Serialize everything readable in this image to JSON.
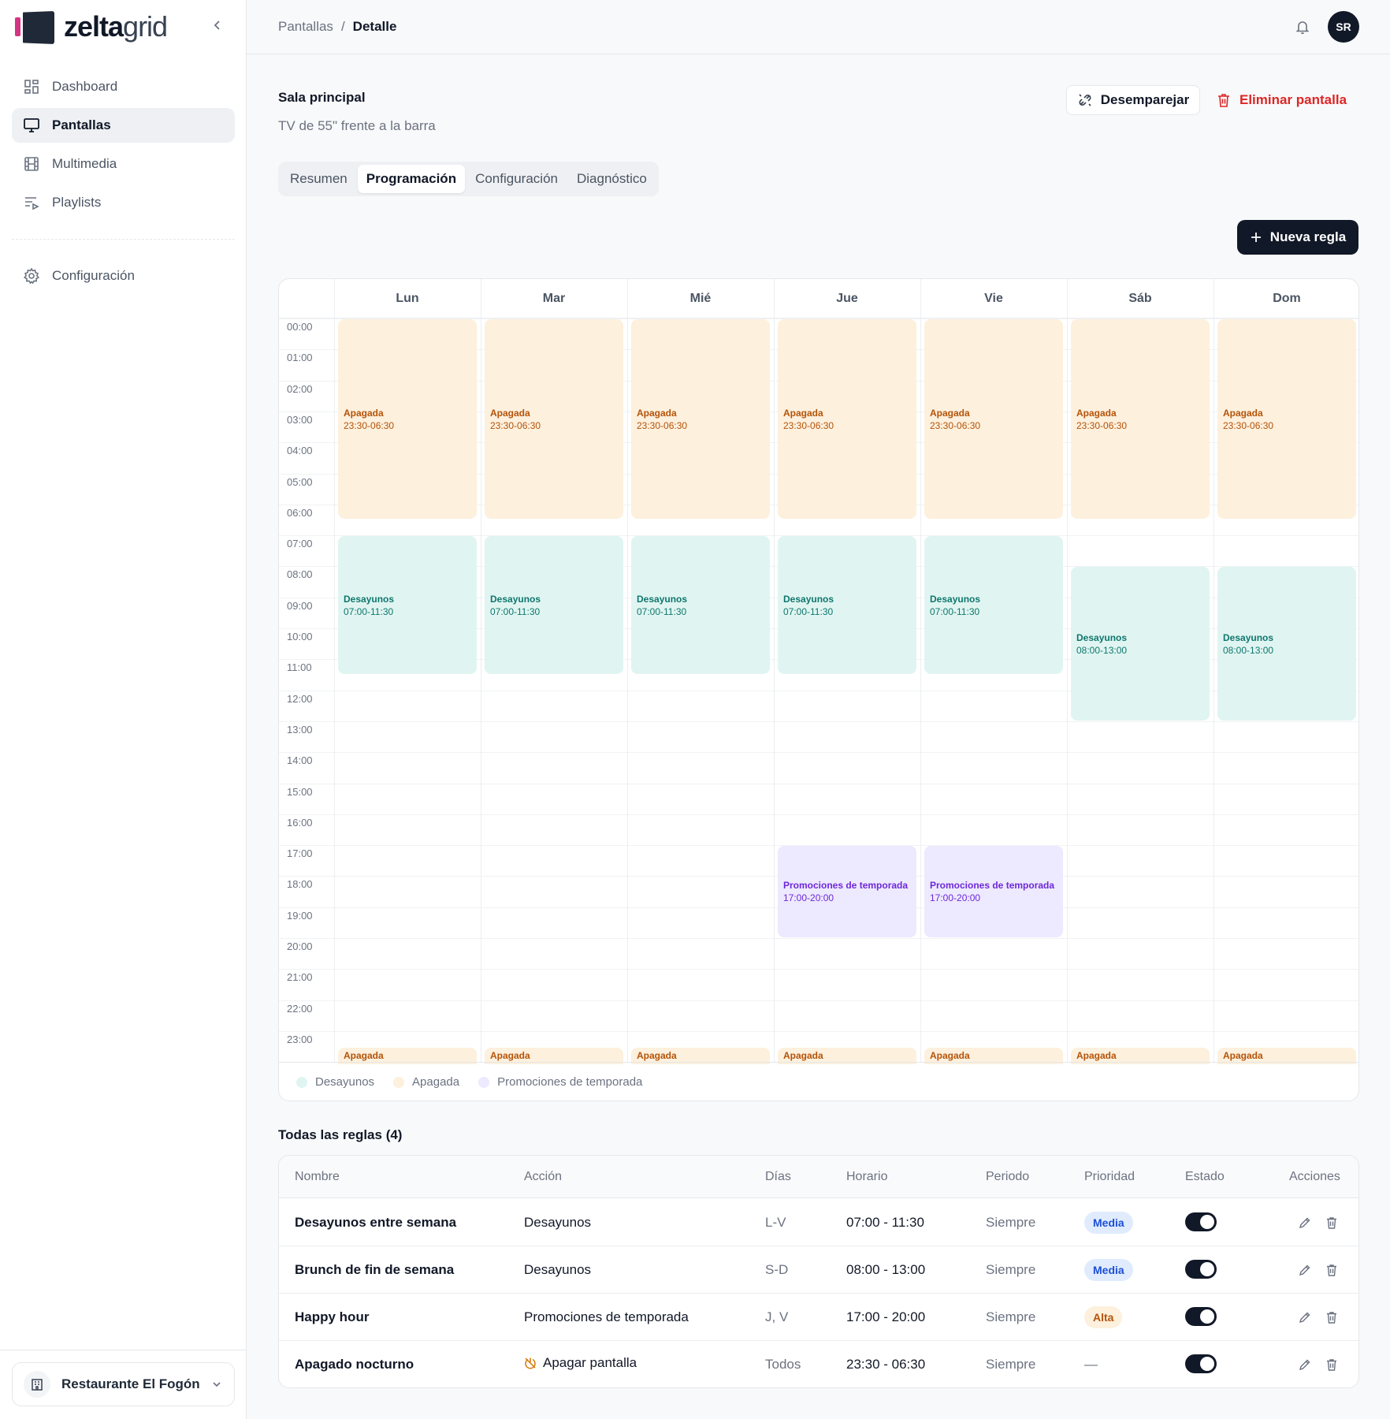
{
  "brand": {
    "name_bold": "zelta",
    "name_light": "grid"
  },
  "sidebar": {
    "items": [
      {
        "label": "Dashboard",
        "icon": "dashboard-icon",
        "active": false
      },
      {
        "label": "Pantallas",
        "icon": "monitor-icon",
        "active": true
      },
      {
        "label": "Multimedia",
        "icon": "film-icon",
        "active": false
      },
      {
        "label": "Playlists",
        "icon": "playlist-icon",
        "active": false
      }
    ],
    "settings": {
      "label": "Configuración",
      "icon": "gear-icon"
    },
    "organization": "Restaurante El Fogón"
  },
  "topbar": {
    "breadcrumb": [
      "Pantallas",
      "/",
      "Detalle"
    ],
    "avatar_initials": "SR"
  },
  "screen": {
    "title": "Sala principal",
    "description": "TV de 55\" frente a la barra",
    "unpair_label": "Desemparejar",
    "delete_label": "Eliminar pantalla"
  },
  "tabs": [
    {
      "label": "Resumen",
      "active": false
    },
    {
      "label": "Programación",
      "active": true
    },
    {
      "label": "Configuración",
      "active": false
    },
    {
      "label": "Diagnóstico",
      "active": false
    }
  ],
  "new_rule_label": "Nueva regla",
  "calendar": {
    "days": [
      "Lun",
      "Mar",
      "Mié",
      "Jue",
      "Vie",
      "Sáb",
      "Dom"
    ],
    "hours": [
      "00:00",
      "01:00",
      "02:00",
      "03:00",
      "04:00",
      "05:00",
      "06:00",
      "07:00",
      "08:00",
      "09:00",
      "10:00",
      "11:00",
      "12:00",
      "13:00",
      "14:00",
      "15:00",
      "16:00",
      "17:00",
      "18:00",
      "19:00",
      "20:00",
      "21:00",
      "22:00",
      "23:00"
    ],
    "events": [
      {
        "day": 0,
        "start": 0,
        "end": 6.5,
        "kind": "off",
        "label": "Apagada",
        "time": "23:30-06:30"
      },
      {
        "day": 1,
        "start": 0,
        "end": 6.5,
        "kind": "off",
        "label": "Apagada",
        "time": "23:30-06:30"
      },
      {
        "day": 2,
        "start": 0,
        "end": 6.5,
        "kind": "off",
        "label": "Apagada",
        "time": "23:30-06:30"
      },
      {
        "day": 3,
        "start": 0,
        "end": 6.5,
        "kind": "off",
        "label": "Apagada",
        "time": "23:30-06:30"
      },
      {
        "day": 4,
        "start": 0,
        "end": 6.5,
        "kind": "off",
        "label": "Apagada",
        "time": "23:30-06:30"
      },
      {
        "day": 5,
        "start": 0,
        "end": 6.5,
        "kind": "off",
        "label": "Apagada",
        "time": "23:30-06:30"
      },
      {
        "day": 6,
        "start": 0,
        "end": 6.5,
        "kind": "off",
        "label": "Apagada",
        "time": "23:30-06:30"
      },
      {
        "day": 0,
        "start": 7,
        "end": 11.5,
        "kind": "bk",
        "label": "Desayunos",
        "time": "07:00-11:30"
      },
      {
        "day": 1,
        "start": 7,
        "end": 11.5,
        "kind": "bk",
        "label": "Desayunos",
        "time": "07:00-11:30"
      },
      {
        "day": 2,
        "start": 7,
        "end": 11.5,
        "kind": "bk",
        "label": "Desayunos",
        "time": "07:00-11:30"
      },
      {
        "day": 3,
        "start": 7,
        "end": 11.5,
        "kind": "bk",
        "label": "Desayunos",
        "time": "07:00-11:30"
      },
      {
        "day": 4,
        "start": 7,
        "end": 11.5,
        "kind": "bk",
        "label": "Desayunos",
        "time": "07:00-11:30"
      },
      {
        "day": 5,
        "start": 8,
        "end": 13,
        "kind": "bk",
        "label": "Desayunos",
        "time": "08:00-13:00"
      },
      {
        "day": 6,
        "start": 8,
        "end": 13,
        "kind": "bk",
        "label": "Desayunos",
        "time": "08:00-13:00"
      },
      {
        "day": 3,
        "start": 17,
        "end": 20,
        "kind": "promo",
        "label": "Promociones de temporada",
        "time": "17:00-20:00"
      },
      {
        "day": 4,
        "start": 17,
        "end": 20,
        "kind": "promo",
        "label": "Promociones de temporada",
        "time": "17:00-20:00"
      },
      {
        "day": 0,
        "start": 23.5,
        "end": 24,
        "kind": "off",
        "label": "Apagada",
        "time": ""
      },
      {
        "day": 1,
        "start": 23.5,
        "end": 24,
        "kind": "off",
        "label": "Apagada",
        "time": ""
      },
      {
        "day": 2,
        "start": 23.5,
        "end": 24,
        "kind": "off",
        "label": "Apagada",
        "time": ""
      },
      {
        "day": 3,
        "start": 23.5,
        "end": 24,
        "kind": "off",
        "label": "Apagada",
        "time": ""
      },
      {
        "day": 4,
        "start": 23.5,
        "end": 24,
        "kind": "off",
        "label": "Apagada",
        "time": ""
      },
      {
        "day": 5,
        "start": 23.5,
        "end": 24,
        "kind": "off",
        "label": "Apagada",
        "time": ""
      },
      {
        "day": 6,
        "start": 23.5,
        "end": 24,
        "kind": "off",
        "label": "Apagada",
        "time": ""
      }
    ],
    "legend": [
      {
        "label": "Desayunos",
        "color": "#e0f5f1"
      },
      {
        "label": "Apagada",
        "color": "#fdf0dd"
      },
      {
        "label": "Promociones de temporada",
        "color": "#ede9fe"
      }
    ]
  },
  "rules": {
    "title": "Todas las reglas (4)",
    "columns": [
      "Nombre",
      "Acción",
      "Días",
      "Horario",
      "Periodo",
      "Prioridad",
      "Estado",
      "Acciones"
    ],
    "rows": [
      {
        "name": "Desayunos entre semana",
        "action": "Desayunos",
        "days": "L-V",
        "schedule": "07:00 - 11:30",
        "period": "Siempre",
        "priority": "Media",
        "enabled": true
      },
      {
        "name": "Brunch de fin de semana",
        "action": "Desayunos",
        "days": "S-D",
        "schedule": "08:00 - 13:00",
        "period": "Siempre",
        "priority": "Media",
        "enabled": true
      },
      {
        "name": "Happy hour",
        "action": "Promociones de temporada",
        "days": "J, V",
        "schedule": "17:00 - 20:00",
        "period": "Siempre",
        "priority": "Alta",
        "enabled": true
      },
      {
        "name": "Apagado nocturno",
        "action": "Apagar pantalla",
        "action_icon": "power-off-icon",
        "days": "Todos",
        "schedule": "23:30 - 06:30",
        "period": "Siempre",
        "priority": "—",
        "enabled": true
      }
    ]
  },
  "colors": {
    "accent": "#111827",
    "danger": "#dc2626",
    "breakfast": "#e0f5f1",
    "off": "#fdf0dd",
    "promo": "#ede9fe"
  }
}
